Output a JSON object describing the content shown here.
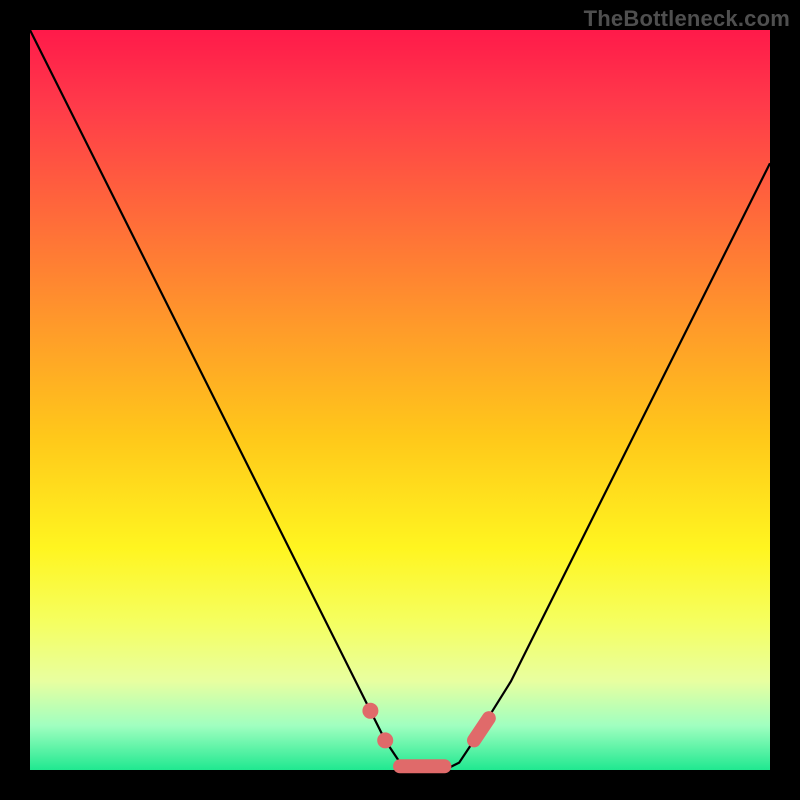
{
  "watermark": "TheBottleneck.com",
  "colors": {
    "frame": "#000000",
    "curve": "#000000",
    "marker": "#e06a6a",
    "gradient_stops": [
      "#ff1a4a",
      "#ff3a4a",
      "#ff6a3a",
      "#ff9a2a",
      "#ffc81a",
      "#fff520",
      "#f5ff60",
      "#e8ffa0",
      "#a0ffc0",
      "#20e890"
    ]
  },
  "chart_data": {
    "type": "line",
    "title": "",
    "xlabel": "",
    "ylabel": "",
    "xlim": [
      0,
      100
    ],
    "ylim": [
      0,
      100
    ],
    "grid": false,
    "legend": false,
    "x": [
      0,
      5,
      10,
      15,
      20,
      25,
      30,
      35,
      40,
      45,
      48,
      50,
      52,
      54,
      56,
      58,
      60,
      65,
      70,
      75,
      80,
      85,
      90,
      95,
      100
    ],
    "y": [
      100,
      90,
      80,
      70,
      60,
      50,
      40,
      30,
      20,
      10,
      4,
      1,
      0,
      0,
      0,
      1,
      4,
      12,
      22,
      32,
      42,
      52,
      62,
      72,
      82
    ],
    "markers": [
      {
        "type": "point",
        "x": 46,
        "y": 8
      },
      {
        "type": "point",
        "x": 48,
        "y": 4
      },
      {
        "type": "segment",
        "x1": 50,
        "y1": 0.5,
        "x2": 56,
        "y2": 0.5
      },
      {
        "type": "segment",
        "x1": 60,
        "y1": 4,
        "x2": 62,
        "y2": 7
      }
    ]
  }
}
